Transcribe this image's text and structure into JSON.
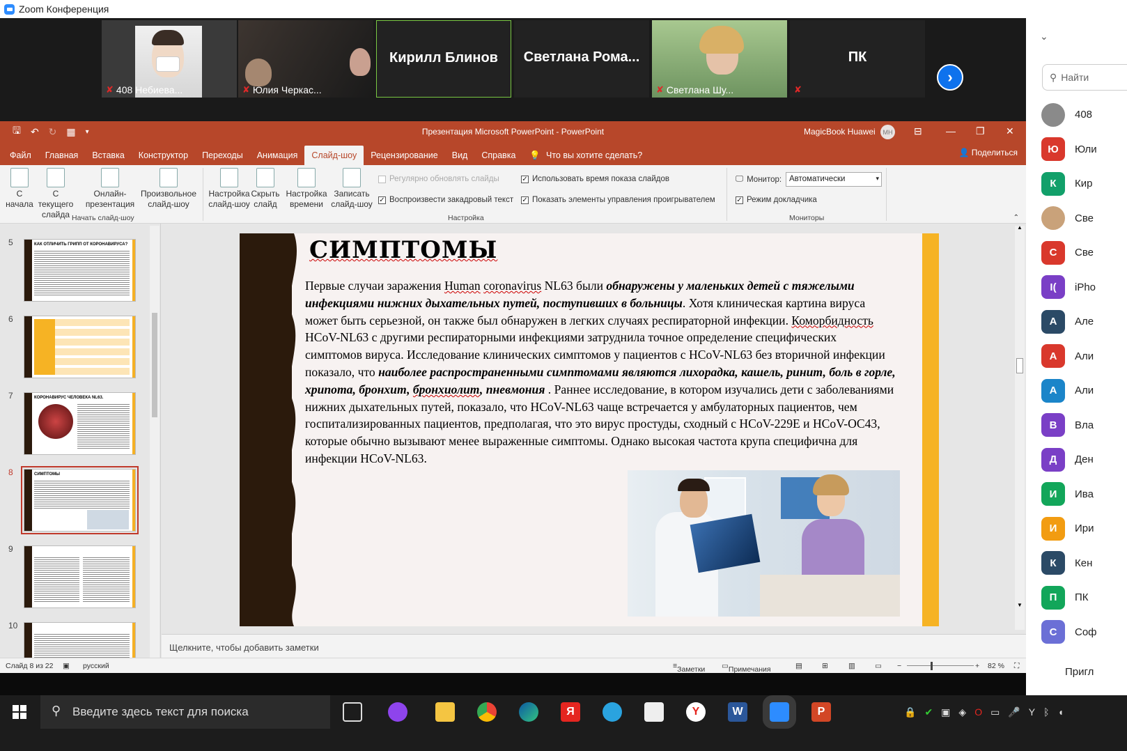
{
  "zoom": {
    "window_title": "Zoom Конференция",
    "tiles": [
      {
        "name": "408  Небиева...",
        "muted": true
      },
      {
        "name": "Юлия Черкас...",
        "muted": true
      },
      {
        "name": "Кирилл Блинов",
        "muted": false
      },
      {
        "name": "Светлана  Рома...",
        "muted": false
      },
      {
        "name": "Светлана Шу...",
        "muted": true
      },
      {
        "name": "ПК",
        "muted": true
      }
    ]
  },
  "participants": {
    "search_placeholder": "Найти",
    "invite_label": "Пригл",
    "list": [
      {
        "initial": "",
        "name": "408",
        "color": "#8a8a8a"
      },
      {
        "initial": "Ю",
        "name": "Юли",
        "color": "#d9382c"
      },
      {
        "initial": "К",
        "name": "Кир",
        "color": "#12a06a"
      },
      {
        "initial": "",
        "name": "Све",
        "color": "#c9a27a"
      },
      {
        "initial": "С",
        "name": "Све",
        "color": "#d9382c"
      },
      {
        "initial": "I(",
        "name": "iPho",
        "color": "#7a3fc6"
      },
      {
        "initial": "А",
        "name": "Але",
        "color": "#2b4a66"
      },
      {
        "initial": "А",
        "name": "Али",
        "color": "#d9382c"
      },
      {
        "initial": "А",
        "name": "Али",
        "color": "#1b85c9"
      },
      {
        "initial": "В",
        "name": "Вла",
        "color": "#7a3fc6"
      },
      {
        "initial": "Д",
        "name": "Ден",
        "color": "#7a3fc6"
      },
      {
        "initial": "И",
        "name": "Ива",
        "color": "#12a65a"
      },
      {
        "initial": "И",
        "name": "Ири",
        "color": "#f29c11"
      },
      {
        "initial": "К",
        "name": "Кен",
        "color": "#2b4a66"
      },
      {
        "initial": "П",
        "name": "ПК",
        "color": "#12a65a"
      },
      {
        "initial": "С",
        "name": "Соф",
        "color": "#6b6fd6"
      }
    ]
  },
  "ppt": {
    "title": "Презентация Microsoft PowerPoint  -  PowerPoint",
    "user": "MagicBook Huawei",
    "user_initials": "MH",
    "share": "Поделиться",
    "tell_me": "Что вы хотите сделать?",
    "tabs": [
      "Файл",
      "Главная",
      "Вставка",
      "Конструктор",
      "Переходы",
      "Анимация",
      "Слайд-шоу",
      "Рецензирование",
      "Вид",
      "Справка"
    ],
    "active_tab": "Слайд-шоу",
    "ribbon": {
      "from_start": "С\nначала",
      "from_current": "С текущего\nслайда",
      "online": "Онлайн-\nпрезентация",
      "custom": "Произвольное\nслайд-шоу",
      "group_start": "Начать слайд-шоу",
      "setup": "Настройка\nслайд-шоу",
      "hide": "Скрыть\nслайд",
      "rehearse": "Настройка\nвремени",
      "record": "Записать\nслайд-шоу",
      "chk_update": "Регулярно обновлять слайды",
      "chk_narration": "Воспроизвести закадровый текст",
      "chk_timings": "Использовать время показа слайдов",
      "chk_controls": "Показать элементы управления проигрывателем",
      "group_setup": "Настройка",
      "monitor_label": "Монитор:",
      "monitor_value": "Автоматически",
      "presenter_view": "Режим докладчика",
      "group_monitors": "Мониторы"
    },
    "thumbs": [
      {
        "num": "5",
        "title": "КАК ОТЛИЧИТЬ ГРИПП ОТ КОРОНАВИРУСА?"
      },
      {
        "num": "6",
        "title": ""
      },
      {
        "num": "7",
        "title": "КОРОНАВИРУС ЧЕЛОВЕКА NL63."
      },
      {
        "num": "8",
        "title": "СИМПТОМЫ"
      },
      {
        "num": "9",
        "title": ""
      },
      {
        "num": "10",
        "title": ""
      }
    ],
    "slide": {
      "title": "СИМПТОМЫ",
      "p1a": "Первые случаи заражения ",
      "p1b": "Human",
      "p1c": " ",
      "p1d": "coronavirus",
      "p1e": " NL63 были ",
      "p1f": "обнаружены у маленьких детей с тяжелыми инфекциями нижних дыхательных путей, поступивших в больницы",
      "p1g": ". Хотя клиническая картина вируса может быть серьезной, он также был обнаружен в легких случаях респираторной инфекции. ",
      "p1h": "Коморбидность",
      "p1i": " HCoV-NL63 с другими респираторными инфекциями затруднила точное определение специфических симптомов вируса. Исследование клинических симптомов у пациентов с HCoV-NL63 без вторичной инфекции показало, что ",
      "p1j": "наиболее распространенными симптомами являются лихорадка, кашель, ринит, боль в горле, хрипота, бронхит, ",
      "p1k": "бронхиолит",
      "p1l": ", пневмония",
      "p1m": " . Раннее исследование, в котором изучались дети с заболеваниями нижних дыхательных путей, показало, что HCoV-NL63 чаще встречается у амбулаторных пациентов, чем госпитализированных пациентов, предполагая, что это вирус простуды, сходный с HCoV-229E и HCoV-OC43, которые обычно вызывают менее выраженные симптомы. Однако высокая частота крупа специфична для инфекции HCoV-NL63."
    },
    "notes_placeholder": "Щелкните, чтобы добавить заметки",
    "status": {
      "slide": "Слайд 8 из 22",
      "lang": "русский",
      "notes": "Заметки",
      "comments": "Примечания",
      "zoom": "82 %"
    }
  },
  "taskbar": {
    "search_placeholder": "Введите здесь текст для поиска"
  }
}
